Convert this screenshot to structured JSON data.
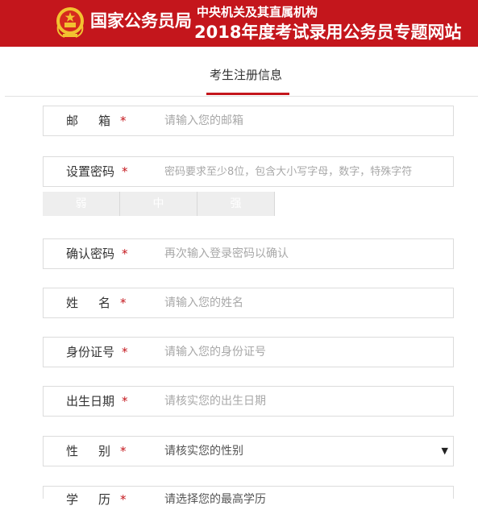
{
  "header": {
    "brand": "国家公务员局",
    "site_sub": "中央机关及其直属机构",
    "site_main": "2018年度考试录用公务员专题网站",
    "emblem_icon": "national-emblem-icon",
    "bg_color": "#c4161c"
  },
  "tab": {
    "label": "考生注册信息",
    "accent": "#c4161c"
  },
  "form": {
    "required_mark": "*",
    "email": {
      "label": "邮箱",
      "placeholder": "请输入您的邮箱"
    },
    "password": {
      "label": "设置密码",
      "placeholder": "密码要求至少8位，包含大小写字母，数字，特殊字符"
    },
    "strength": [
      "弱",
      "中",
      "强"
    ],
    "confirm_password": {
      "label": "确认密码",
      "placeholder": "再次输入登录密码以确认"
    },
    "name": {
      "label": "姓名",
      "placeholder": "请输入您的姓名"
    },
    "id_number": {
      "label": "身份证号",
      "placeholder": "请输入您的身份证号"
    },
    "birth_date": {
      "label": "出生日期",
      "placeholder": "请核实您的出生日期"
    },
    "gender": {
      "label": "性别",
      "selected": "请核实您的性别",
      "caret_icon": "caret-down-icon"
    },
    "education": {
      "label": "学历",
      "selected": "请选择您的最高学历"
    }
  }
}
